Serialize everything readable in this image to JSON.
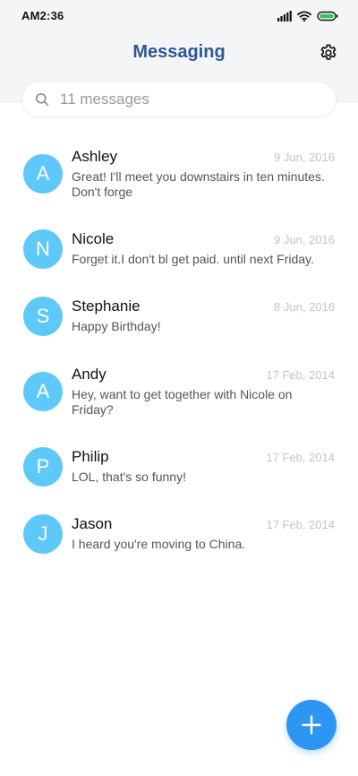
{
  "status_bar": {
    "time": "AM2:36",
    "icons": [
      "signal-icon",
      "wifi-icon",
      "battery-icon"
    ]
  },
  "header": {
    "title": "Messaging",
    "settings_icon": "gear-icon"
  },
  "search": {
    "placeholder": "11 messages",
    "icon": "search-icon"
  },
  "conversations": [
    {
      "initial": "A",
      "name": "Ashley",
      "date": "9 Jun, 2016",
      "preview": "Great! I'll meet you downstairs in ten minutes. Don't forge"
    },
    {
      "initial": "N",
      "name": "Nicole",
      "date": "9 Jun, 2016",
      "preview": "Forget it.I don't bl get paid. until next Friday."
    },
    {
      "initial": "S",
      "name": "Stephanie",
      "date": "8 Jun, 2016",
      "preview": "Happy Birthday!"
    },
    {
      "initial": "A",
      "name": "Andy",
      "date": "17 Feb, 2014",
      "preview": "Hey, want to get together with Nicole on Friday?"
    },
    {
      "initial": "P",
      "name": "Philip",
      "date": "17 Feb, 2014",
      "preview": "LOL, that's so funny!"
    },
    {
      "initial": "J",
      "name": "Jason",
      "date": "17 Feb, 2014",
      "preview": "I heard you're moving to China."
    }
  ],
  "fab": {
    "icon": "plus-icon"
  },
  "colors": {
    "title": "#2d5796",
    "avatar": "#5ec8f8",
    "fab": "#2d96f3",
    "header_bg": "#f4f5f7"
  }
}
